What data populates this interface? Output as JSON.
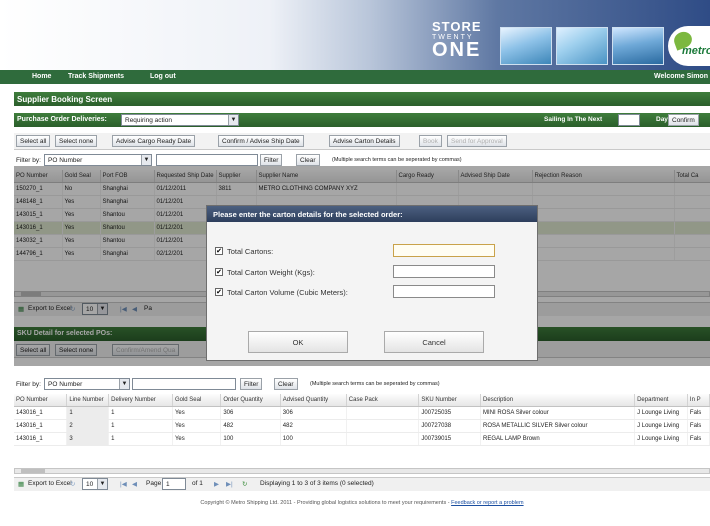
{
  "brand": {
    "line1": "STORE",
    "line2": "TWENTY",
    "line3": "ONE",
    "partner": "metro"
  },
  "nav": {
    "home": "Home",
    "track": "Track Shipments",
    "logout": "Log out",
    "welcome": "Welcome Simon"
  },
  "screen_title": "Supplier Booking Screen",
  "po_section": {
    "deliveries_label": "Purchase Order Deliveries:",
    "deliveries_value": "Requiring action",
    "sailing_label": "Sailing In The Next",
    "days_label": "Days",
    "confirm_label": "Confirm",
    "buttons": {
      "select_all": "Select all",
      "select_none": "Select none",
      "advise_cargo": "Advise Cargo Ready Date",
      "confirm_advise": "Confirm / Advise Ship Date",
      "advise_carton": "Advise Carton Details",
      "book": "Book",
      "send": "Send for Approval"
    },
    "filter": {
      "label": "Filter by:",
      "field": "PO Number",
      "filter_btn": "Filter",
      "clear_btn": "Clear",
      "hint": "(Multiple search terms can be seperated by commas)"
    },
    "columns": [
      "PO Number",
      "Gold Seal",
      "Port FOB",
      "Requested Ship Date",
      "Supplier",
      "Supplier Name",
      "Cargo Ready",
      "Advised Ship Date",
      "Rejection Reason",
      "Total Ca"
    ],
    "rows": [
      [
        "150270_1",
        "No",
        "Shanghai",
        "01/12/2011",
        "3811",
        "METRO CLOTHING COMPANY XYZ",
        "",
        "",
        "",
        ""
      ],
      [
        "148148_1",
        "Yes",
        "Shanghai",
        "01/12/201",
        "",
        "",
        "",
        "",
        "",
        ""
      ],
      [
        "143015_1",
        "Yes",
        "Shantou",
        "01/12/201",
        "",
        "",
        "",
        "",
        "",
        ""
      ],
      [
        "143016_1",
        "Yes",
        "Shantou",
        "01/12/201",
        "",
        "",
        "",
        "",
        "",
        ""
      ],
      [
        "143032_1",
        "Yes",
        "Shantou",
        "01/12/201",
        "",
        "",
        "",
        "",
        "",
        ""
      ],
      [
        "144796_1",
        "Yes",
        "Shanghai",
        "02/12/201",
        "",
        "",
        "",
        "",
        "",
        ""
      ]
    ],
    "pager": {
      "export": "Export to Excel",
      "page_size": "10",
      "page_label": "Pa"
    }
  },
  "sku_section": {
    "title": "SKU Detail for selected POs:",
    "buttons": {
      "select_all": "Select all",
      "select_none": "Select none",
      "confirm_amend": "Confirm/Amend Qua"
    },
    "filter": {
      "label": "Filter by:",
      "field": "PO Number",
      "filter_btn": "Filter",
      "clear_btn": "Clear",
      "hint": "(Multiple search terms can be seperated by commas)"
    },
    "columns": [
      "PO Number",
      "Line Number",
      "Delivery Number",
      "Gold Seal",
      "Order Quantity",
      "Advised Quantity",
      "Case Pack",
      "SKU Number",
      "Description",
      "Department",
      "In P"
    ],
    "rows": [
      [
        "143016_1",
        "1",
        "1",
        "Yes",
        "306",
        "306",
        "",
        "J00725035",
        "MINI ROSA Silver colour",
        "J Lounge Living",
        "Fals"
      ],
      [
        "143016_1",
        "2",
        "1",
        "Yes",
        "482",
        "482",
        "",
        "J00727038",
        "ROSA METALLIC SILVER Silver colour",
        "J Lounge Living",
        "Fals"
      ],
      [
        "143016_1",
        "3",
        "1",
        "Yes",
        "100",
        "100",
        "",
        "J00739015",
        "REGAL LAMP Brown",
        "J Lounge Living",
        "Fals"
      ]
    ],
    "pager": {
      "export": "Export to Excel",
      "page_size": "10",
      "page_label": "Page",
      "page_value": "1",
      "of_label": "of 1",
      "display": "Displaying 1 to 3 of 3 items (0 selected)"
    }
  },
  "dialog": {
    "title": "Please enter the carton details for the selected order:",
    "fields": [
      {
        "label": "Total Cartons:",
        "checked": "✔"
      },
      {
        "label": "Total Carton Weight (Kgs):",
        "checked": "✔"
      },
      {
        "label": "Total Carton Volume (Cubic Meters):",
        "checked": "✔"
      }
    ],
    "ok": "OK",
    "cancel": "Cancel"
  },
  "footer": {
    "text": "Copyright © Metro Shipping Ltd. 2011 - Providing global logistics solutions to meet your requirements -",
    "link": "Feedback or report a problem"
  },
  "colors": {
    "nav_green": "#2f6b3c",
    "header_blue": "#2f4c86",
    "selected_row": "#dfe9cf"
  },
  "icons": [
    "excel-icon",
    "first-page-icon",
    "prev-page-icon",
    "next-page-icon",
    "last-page-icon",
    "refresh-icon",
    "checkbox-checked-icon",
    "dropdown-arrow-icon"
  ]
}
